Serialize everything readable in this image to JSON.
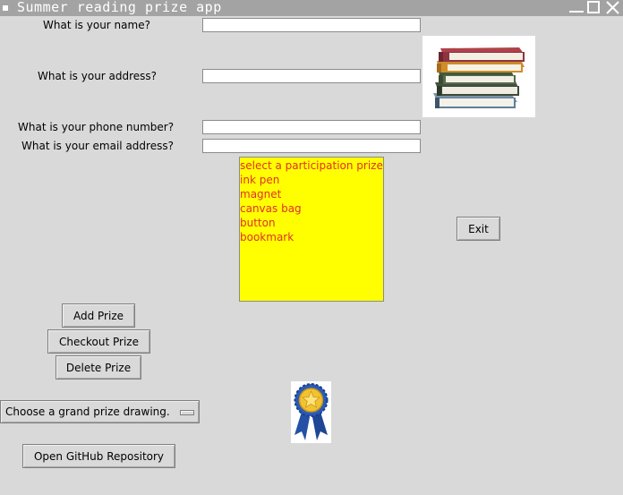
{
  "window": {
    "title": "Summer reading prize app"
  },
  "form": {
    "name_label": "What is your name?",
    "name_value": "",
    "address_label": "What is your address?",
    "address_value": "",
    "phone_label": "What is your phone number?",
    "phone_value": "",
    "email_label": "What is your email address?",
    "email_value": ""
  },
  "prize_list": {
    "items": [
      "select a participation prize",
      "ink pen",
      "magnet",
      "canvas bag",
      "button",
      "bookmark"
    ]
  },
  "buttons": {
    "exit": "Exit",
    "add_prize": "Add Prize",
    "checkout_prize": "Checkout Prize",
    "delete_prize": "Delete Prize",
    "open_github": "Open GitHub Repository"
  },
  "grand_prize_menu": {
    "selected": "Choose a grand prize drawing."
  },
  "images": {
    "books": "stack-of-books-image",
    "ribbon": "award-ribbon-image"
  },
  "colors": {
    "listbox_bg": "#ffff00",
    "listbox_text": "#e0302a",
    "ribbon_blue": "#2451a6",
    "medal_gold": "#f2c230"
  }
}
